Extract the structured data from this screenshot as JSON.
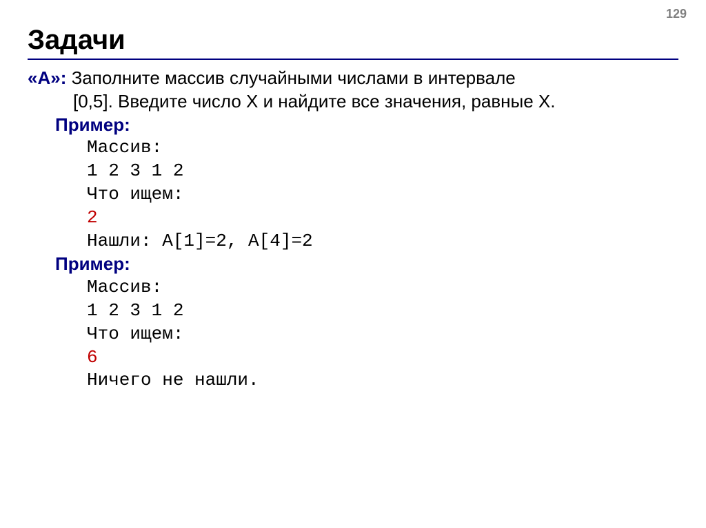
{
  "page_number": "129",
  "title": "Задачи",
  "task": {
    "label": "«A»:",
    "desc_line1": " Заполните массив случайными числами в интервале",
    "desc_line2": "[0,5]. Введите число X и найдите все значения, равные X."
  },
  "example1": {
    "label": "Пример:",
    "lines": {
      "l1": "Массив:",
      "l2": "1 2 3 1 2",
      "l3": "Что ищем:",
      "l4": "2",
      "l5": "Нашли: A[1]=2, A[4]=2"
    }
  },
  "example2": {
    "label": "Пример:",
    "lines": {
      "l1": "Массив:",
      "l2": "1 2 3 1 2",
      "l3": "Что ищем:",
      "l4": "6",
      "l5": "Ничего не нашли."
    }
  }
}
